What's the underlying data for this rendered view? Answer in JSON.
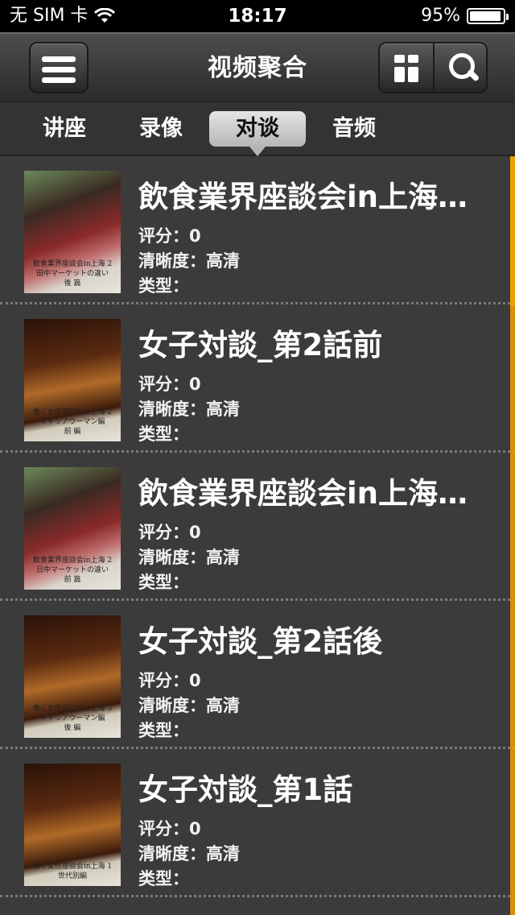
{
  "status": {
    "carrier": "无 SIM 卡",
    "time": "18:17",
    "battery": "95%",
    "battery_level": 0.95
  },
  "nav": {
    "title": "视频聚合"
  },
  "tabs": [
    {
      "label": "讲座"
    },
    {
      "label": "录像"
    },
    {
      "label": "对谈",
      "active": true
    },
    {
      "label": "音频"
    }
  ],
  "meta_labels": {
    "rating": "评分：",
    "clarity": "清晰度：",
    "type": "类型："
  },
  "items": [
    {
      "title": "飲食業界座談会in上海…",
      "rating": "0",
      "clarity": "高清",
      "type": "",
      "thumb_caption": "飲食業界座談会in上海 2\n田中マーケットの違い\n後 篇"
    },
    {
      "title": "女子対談_第2話前",
      "rating": "0",
      "clarity": "高清",
      "type": "",
      "thumb_caption": "働く女性座談会in上海 2\nキャリアウーマン編\n前 編"
    },
    {
      "title": "飲食業界座談会in上海…",
      "rating": "0",
      "clarity": "高清",
      "type": "",
      "thumb_caption": "飲食業界座談会in上海 2\n日中マーケットの違い\n前 篇"
    },
    {
      "title": "女子対談_第2話後",
      "rating": "0",
      "clarity": "高清",
      "type": "",
      "thumb_caption": "働く女性座談会in上海 3\nキャリアウーマン編\n後 編"
    },
    {
      "title": "女子対談_第1話",
      "rating": "0",
      "clarity": "高清",
      "type": "",
      "thumb_caption": "働く女性座談会in上海 1\n世代別編"
    }
  ],
  "colors": {
    "accent": "#f0a000",
    "background": "#3b3b3b"
  }
}
